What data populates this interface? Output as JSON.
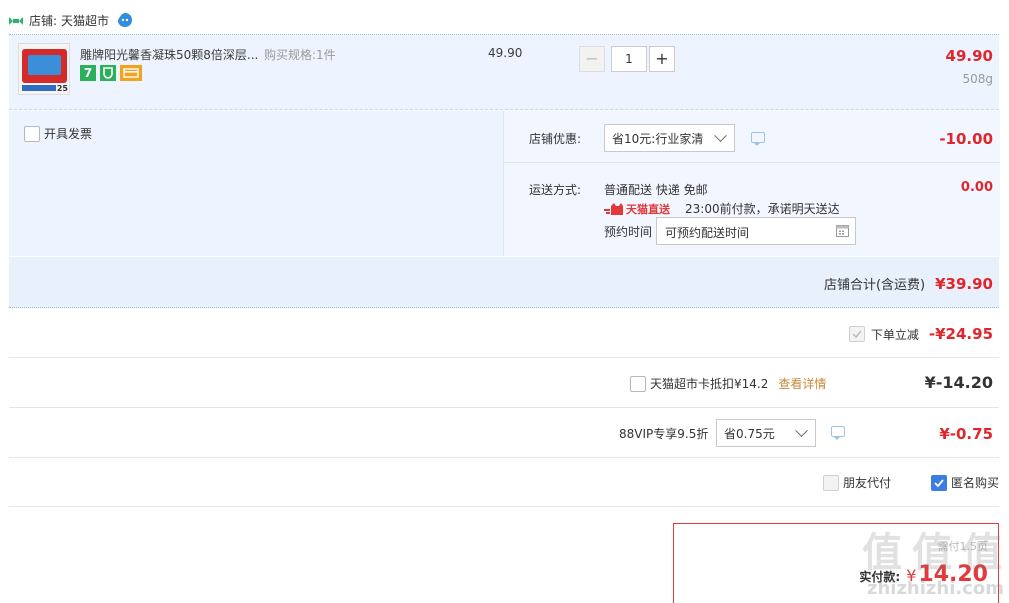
{
  "shop": {
    "label": "店铺:",
    "name": "天猫超市"
  },
  "product": {
    "title": "雕牌阳光馨香凝珠50颗8倍深层...",
    "spec_label": "购买规格:",
    "spec_value": "1件",
    "unit_price": "49.90",
    "quantity": "1",
    "minus": "−",
    "plus": "+",
    "subtotal": "49.90",
    "weight": "508g",
    "badge_seven": "7",
    "thumb_badge": "25"
  },
  "invoice": {
    "label": "开具发票"
  },
  "discount": {
    "label": "店铺优惠:",
    "selected": "省10元:行业家清",
    "amount": "-10.00"
  },
  "delivery": {
    "label": "运送方式:",
    "method": "普通配送 快递 免邮",
    "amount": "0.00",
    "brand": "天猫直送",
    "promise": "23:00前付款，承诺明天送达",
    "appoint_label": "预约时间",
    "appoint_placeholder": "可预约配送时间"
  },
  "shop_total": {
    "label": "店铺合计(含运费)",
    "amount": "¥39.90"
  },
  "instant": {
    "label": "下单立减",
    "amount": "-¥24.95"
  },
  "card": {
    "label": "天猫超市卡抵扣¥14.2",
    "link": "查看详情",
    "amount": "¥-14.20"
  },
  "vip": {
    "label": "88VIP专享9.5折",
    "selected": "省0.75元",
    "amount": "¥-0.75"
  },
  "options": {
    "friend_pay": "朋友代付",
    "anonymous": "匿名购买"
  },
  "footer": {
    "small": "需付1.5页",
    "pay_label": "实付款:",
    "currency": "¥",
    "pay_amount": "14.20",
    "watermark": "值 值 值",
    "watermark_url": "zhizhizhi.com"
  },
  "colors": {
    "accent_red": "#e4393c",
    "bg_blue": "#eef4ff",
    "border_blue": "#b7cff0",
    "check_blue": "#3b7de0"
  }
}
